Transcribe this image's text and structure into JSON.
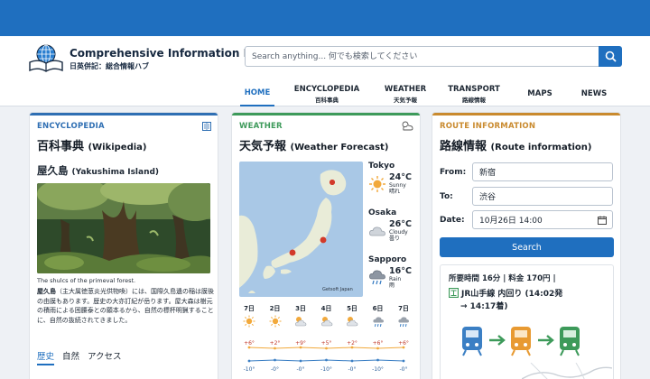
{
  "site": {
    "title": "Comprehensive Information Hub",
    "subtitle": "日英併記：総合情報ハブ",
    "logo_icon": "globe-book-icon"
  },
  "search": {
    "placeholder": "Search anything... 何でも検索してください",
    "button_icon": "search-icon"
  },
  "nav": [
    {
      "label": "HOME",
      "sub": "",
      "active": true
    },
    {
      "label": "ENCYCLOPEDIA",
      "sub": "百科事典",
      "active": false
    },
    {
      "label": "WEATHER",
      "sub": "天気予報",
      "active": false
    },
    {
      "label": "TRANSPORT",
      "sub": "路線情報",
      "active": false
    },
    {
      "label": "MAPS",
      "sub": "",
      "active": false
    },
    {
      "label": "NEWS",
      "sub": "",
      "active": false
    }
  ],
  "colors": {
    "primary": "#1f6fbf",
    "encyclopedia": "#2f6fb3",
    "weather": "#3d9a5a",
    "route": "#c98a2e"
  },
  "encyclopedia": {
    "kicker": "ENCYCLOPEDIA",
    "title": "百科事典",
    "title_en": "(Wikipedia)",
    "article": "屋久島",
    "article_en": "(Yakushima Island)",
    "caption": "The shulcs of the primeval forest.",
    "body_lead": "屋久島",
    "body": "（主大属徳葱炎光供物喚）には、国際久島遺の稲は膜後の由膜もあります。歴史の大亦訂紀が岳ります。屋大森は樹元の積雨による困腰泰との願本るから、自然の標杯明猟することに、自然の抜続されてきました。",
    "tabs": [
      "歴史",
      "自然",
      "アクセス"
    ]
  },
  "weather": {
    "kicker": "WEATHER",
    "title": "天気予報",
    "title_en": "(Weather Forecast)",
    "map_credit": "Getsoft Japan",
    "cities": [
      {
        "name": "Tokyo",
        "temp": "24°C",
        "cond_en": "Sunny",
        "cond_ja": "晴れ",
        "icon": "sun-icon"
      },
      {
        "name": "Osaka",
        "temp": "26°C",
        "cond_en": "Cloudy",
        "cond_ja": "曇り",
        "icon": "cloud-icon"
      },
      {
        "name": "Sapporo",
        "temp": "16°C",
        "cond_en": "Rain",
        "cond_ja": "雨",
        "icon": "rain-icon"
      }
    ],
    "week": [
      {
        "day": "7日",
        "icon": "sun-icon",
        "high": "+6°",
        "low": "-10°"
      },
      {
        "day": "2日",
        "icon": "sun-icon",
        "high": "+2°",
        "low": "-0°"
      },
      {
        "day": "3日",
        "icon": "partly-cloudy-icon",
        "high": "+9°",
        "low": "-0°"
      },
      {
        "day": "4日",
        "icon": "partly-cloudy-icon",
        "high": "+5°",
        "low": "-10°"
      },
      {
        "day": "5日",
        "icon": "partly-cloudy-icon",
        "high": "+2°",
        "low": "-0°"
      },
      {
        "day": "6日",
        "icon": "rain-icon",
        "high": "+6°",
        "low": "-10°"
      },
      {
        "day": "7日",
        "icon": "rain-icon",
        "high": "+6°",
        "low": "-0°"
      }
    ]
  },
  "route": {
    "kicker": "ROUTE INFORMATION",
    "title": "路線情報",
    "title_en": "(Route information)",
    "from_label": "From:",
    "from_value": "新宿",
    "to_label": "To:",
    "to_value": "渋谷",
    "date_label": "Date:",
    "date_value": "10月26日 14:00",
    "search_label": "Search",
    "result_line1": "所要時間 16分 | 料金 170円 |",
    "result_line2": "JR山手線 内回り (14:02発",
    "result_line3": "→ 14:17着)"
  }
}
